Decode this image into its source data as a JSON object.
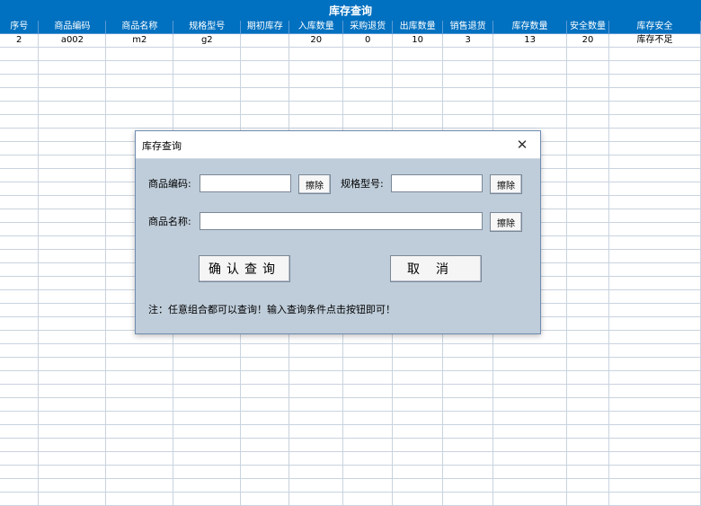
{
  "sheet": {
    "title": "库存查询",
    "headers": [
      "序号",
      "商品编码",
      "商品名称",
      "规格型号",
      "期初库存",
      "入库数量",
      "采购退货",
      "出库数量",
      "销售退货",
      "库存数量",
      "安全数量",
      "库存安全"
    ],
    "rows": [
      [
        "2",
        "a002",
        "m2",
        "g2",
        "",
        "20",
        "0",
        "10",
        "3",
        "13",
        "20",
        "库存不足"
      ]
    ],
    "empty_row_count": 34
  },
  "dialog": {
    "title": "库存查询",
    "close_glyph": "✕",
    "code_label": "商品编码:",
    "code_value": "",
    "spec_label": "规格型号:",
    "spec_value": "",
    "name_label": "商品名称:",
    "name_value": "",
    "clear_label": "擦除",
    "confirm_label": "确认查询",
    "cancel_label": "取消",
    "note": "注：任意组合都可以查询！输入查询条件点击按钮即可！"
  }
}
